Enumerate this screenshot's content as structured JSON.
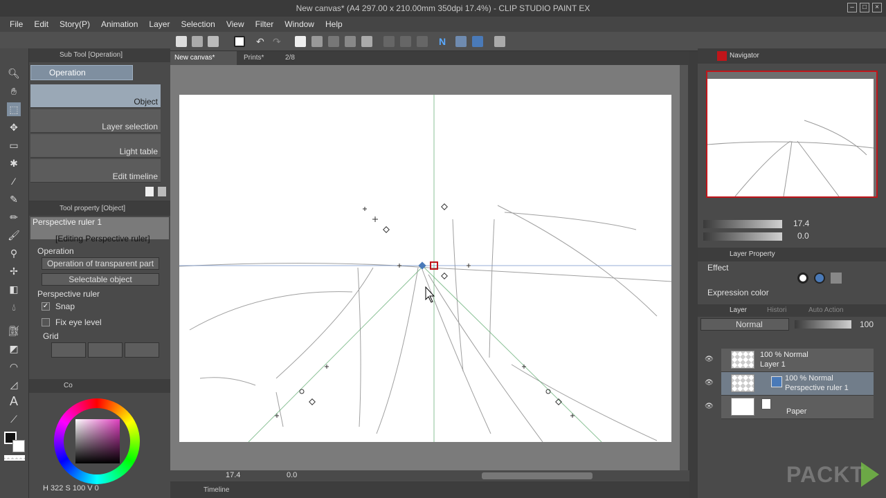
{
  "window": {
    "title": "New canvas* (A4 297.00 x 210.00mm 350dpi 17.4%)  - CLIP STUDIO PAINT EX"
  },
  "menu": [
    "File",
    "Edit",
    "Story(P)",
    "Animation",
    "Layer",
    "Selection",
    "View",
    "Filter",
    "Window",
    "Help"
  ],
  "subtool": {
    "header": "Sub Tool [Operation]",
    "group_tab": "Operation",
    "items": [
      "Object",
      "Layer selection",
      "Light table",
      "Edit timeline"
    ]
  },
  "toolproperty": {
    "header": "Tool property [Object]",
    "ruler_name": "Perspective ruler 1",
    "editing_label": "[Editing Perspective ruler]",
    "operation_label": "Operation",
    "operation_value": "Operation of transparent part",
    "selectable_value": "Selectable object",
    "perspective_label": "Perspective ruler",
    "snap_label": "Snap",
    "snap_checked": true,
    "fix_eye_label": "Fix eye level",
    "fix_eye_checked": false,
    "grid_label": "Grid"
  },
  "color": {
    "tab_label": "Co",
    "h": "322",
    "s": "100",
    "v": "0",
    "h_label": "H",
    "s_label": "S",
    "v_label": "V"
  },
  "tabs": {
    "canvas": "New canvas*",
    "prints": "Prints*",
    "prints_page": "2/8"
  },
  "bottom": {
    "zoom": "17.4",
    "angle": "0.0"
  },
  "timeline": {
    "label": "Timeline"
  },
  "navigator": {
    "header": "Navigator",
    "zoom": "17.4",
    "angle": "0.0"
  },
  "layer_property": {
    "header": "Layer Property",
    "effect_label": "Effect",
    "expression_label": "Expression color"
  },
  "layer_panel": {
    "tabs": [
      "Layer",
      "Histori",
      "Auto Action"
    ],
    "blend_mode": "Normal",
    "opacity": "100",
    "layers": [
      {
        "opacity": "100 %",
        "mode": "Normal",
        "name": "Layer 1"
      },
      {
        "opacity": "100 %",
        "mode": "Normal",
        "name": "Perspective ruler 1"
      },
      {
        "name": "Paper"
      }
    ]
  },
  "watermark": "PACKT"
}
